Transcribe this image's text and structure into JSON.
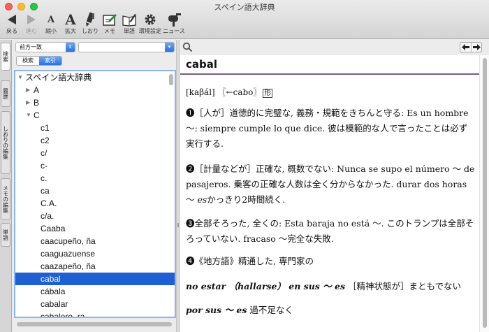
{
  "window": {
    "title": "スペイン語大辞典"
  },
  "toolbar": {
    "buttons": [
      {
        "label": "戻る"
      },
      {
        "label": "進む"
      },
      {
        "label": "縮小"
      },
      {
        "label": "拡大"
      },
      {
        "label": "しおり"
      },
      {
        "label": "メモ"
      },
      {
        "label": "単語"
      },
      {
        "label": "環境設定"
      },
      {
        "label": "ニュース"
      }
    ],
    "shrink_glyph": "A",
    "enlarge_glyph": "A"
  },
  "side_tabs": [
    {
      "label": "検索"
    },
    {
      "label": "履歴"
    },
    {
      "label": "しおりの編集"
    },
    {
      "label": "メモの編集"
    },
    {
      "label": "単語"
    }
  ],
  "search": {
    "mode": "前方一致",
    "query": "",
    "segments": [
      "検索",
      "索引"
    ]
  },
  "tree": {
    "root": "スペイン語大辞典",
    "groups": [
      "A",
      "B",
      "C"
    ],
    "items": [
      "c1",
      "c2",
      "c/",
      "c-",
      "c.",
      "ca",
      "C.A.",
      "c/a.",
      "Caaba",
      "caacupeño, ña",
      "caaguazuense",
      "caazapeño, ña",
      "cabal",
      "cábala",
      "cabalar",
      "cabalero, ra"
    ],
    "selected": "cabal"
  },
  "entry": {
    "headword": "cabal",
    "pronunciation": "[kaβál]",
    "etymology": "〖←cabo〗",
    "pos": "形",
    "senses": [
      {
        "num": "❶",
        "label": "［人が］",
        "text": "道徳的に完璧な, 義務・規範をきちんと守る: Es un hombre 〜: siempre cumple lo que dice. 彼は模範的な人で言ったことは必ず実行する."
      },
      {
        "num": "❷",
        "label": "［計量などが］",
        "text": "正確な, 概数でない: Nunca se supo el número 〜 de pasajeros. 乗客の正確な人数は全く分からなかった. durar dos horas 〜 ",
        "italic": "es",
        "tail": "かっきり2時間続く."
      },
      {
        "num": "❸",
        "label": "",
        "text": "全部そろった, 全くの: Esta baraja no está 〜. このトランプは全部そろっていない. fracaso 〜完全な失敗."
      },
      {
        "num": "❹",
        "label": "《地方語》",
        "text": "精通した, 専門家の"
      }
    ],
    "phrases": [
      {
        "phrase": "no estar （hallarse） en sus 〜 es",
        "meaning": "［精神状態が］まともでない"
      },
      {
        "phrase": "por sus 〜 es",
        "meaning": "過不足なく"
      }
    ]
  },
  "colors": {
    "selection": "#1f5fd4",
    "accent_rule": "#7b5a86",
    "focus_ring": "#8bb5ef"
  }
}
